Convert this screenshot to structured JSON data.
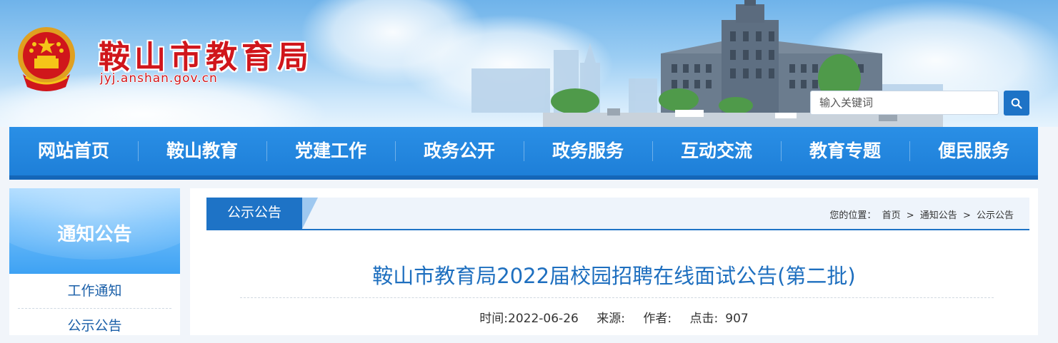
{
  "header": {
    "site_title": "鞍山市教育局",
    "site_domain": "jyj.anshan.gov.cn",
    "search_placeholder": "输入关键词",
    "emblem_icon": "national-emblem-icon",
    "search_icon": "search-icon"
  },
  "nav": {
    "items": [
      "网站首页",
      "鞍山教育",
      "党建工作",
      "政务公开",
      "政务服务",
      "互动交流",
      "教育专题",
      "便民服务"
    ]
  },
  "sidebar": {
    "title": "通知公告",
    "links": [
      "工作通知",
      "公示公告"
    ]
  },
  "main": {
    "tab_label": "公示公告",
    "breadcrumb": {
      "prefix": "您的位置：",
      "items": [
        "首页",
        "通知公告",
        "公示公告"
      ],
      "separator": ">"
    },
    "article_title": "鞍山市教育局2022届校园招聘在线面试公告(第二批)",
    "meta": {
      "time": "时间:2022-06-26",
      "source": "来源:",
      "author": "作者:",
      "clicks_label": "点击:",
      "clicks_value": "907"
    }
  },
  "colors": {
    "brand_red": "#d0161b",
    "nav_blue": "#1e7fd8",
    "link_blue": "#1a5fa8",
    "title_blue": "#1e6fbf"
  }
}
